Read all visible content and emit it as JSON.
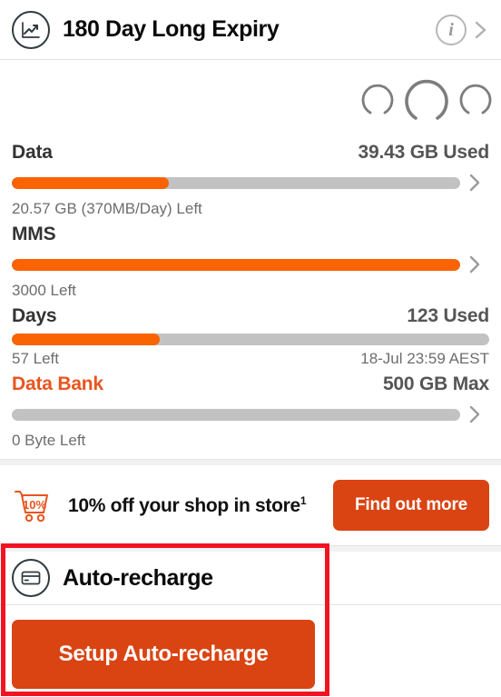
{
  "header": {
    "plan_icon": "trending-chart-icon",
    "title": "180 Day Long Expiry",
    "info_icon": "info-icon",
    "chevron_icon": "chevron-right-icon"
  },
  "gauges": {
    "icon_name": "ring-gauge-icon",
    "count": 3
  },
  "usage": {
    "rows": [
      {
        "label": "Data",
        "value": "39.43 GB Used",
        "sub_left": "20.57 GB (370MB/Day) Left",
        "sub_right": "",
        "fill_percent": 35,
        "has_chevron": true,
        "accent": false
      },
      {
        "label": "MMS",
        "value": "",
        "sub_left": "3000 Left",
        "sub_right": "",
        "fill_percent": 100,
        "has_chevron": true,
        "accent": false
      },
      {
        "label": "Days",
        "value": "123 Used",
        "sub_left": "57 Left",
        "sub_right": "18-Jul 23:59 AEST",
        "fill_percent": 31,
        "has_chevron": false,
        "accent": false
      },
      {
        "label": "Data Bank",
        "value": "500 GB Max",
        "sub_left": "0 Byte Left",
        "sub_right": "",
        "fill_percent": 0,
        "has_chevron": true,
        "accent": true
      }
    ]
  },
  "promo": {
    "icon": "shopping-cart-discount-icon",
    "icon_label": "10%",
    "text": "10% off your shop in store",
    "footnote": "1",
    "button_label": "Find out more"
  },
  "auto_recharge": {
    "icon": "credit-card-icon",
    "title": "Auto-recharge",
    "button_label": "Setup Auto-recharge"
  },
  "colors": {
    "bar_fill": "#f96302",
    "bar_track": "#c2c2c2",
    "button": "#d94412",
    "accent_text": "#e8551f",
    "annotation": "#f21322"
  }
}
